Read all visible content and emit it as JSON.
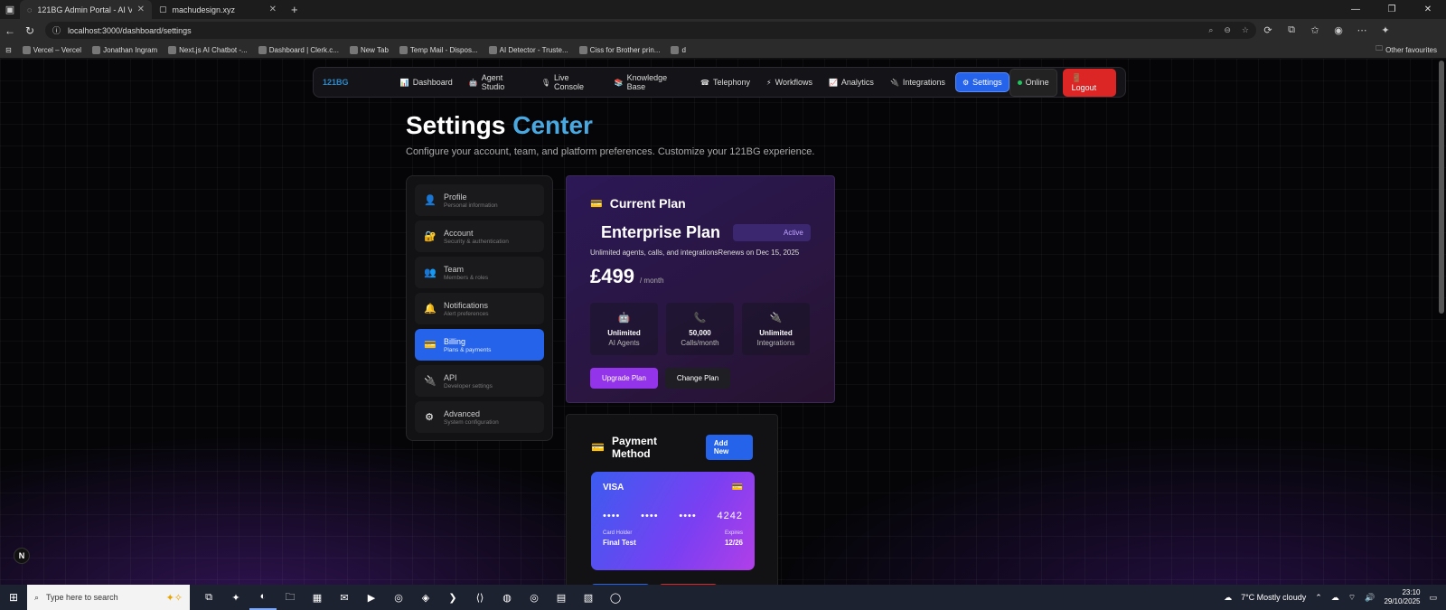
{
  "browser": {
    "tabs": [
      {
        "title": "121BG Admin Portal - AI Voice A",
        "active": true
      },
      {
        "title": "machudesign.xyz",
        "active": false
      }
    ],
    "url": "localhost:3000/dashboard/settings",
    "bookmarks": [
      "Vercel – Vercel",
      "Jonathan Ingram",
      "Next.js AI Chatbot -...",
      "Dashboard | Clerk.c...",
      "New Tab",
      "Temp Mail - Dispos...",
      "AI Detector - Truste...",
      "Ciss for Brother prin...",
      "d"
    ],
    "other_bookmarks": "Other favourites"
  },
  "nav": {
    "logo": "121BG",
    "items": [
      {
        "label": "Dashboard",
        "icon": "📊"
      },
      {
        "label": "Agent Studio",
        "icon": "🤖"
      },
      {
        "label": "Live Console",
        "icon": "🎙"
      },
      {
        "label": "Knowledge Base",
        "icon": "📚"
      },
      {
        "label": "Telephony",
        "icon": "☎"
      },
      {
        "label": "Workflows",
        "icon": "⚡"
      },
      {
        "label": "Analytics",
        "icon": "📈"
      },
      {
        "label": "Integrations",
        "icon": "🔌"
      },
      {
        "label": "Settings",
        "icon": "⚙"
      }
    ],
    "online": "Online",
    "logout": "Logout"
  },
  "header": {
    "title": "Settings",
    "title_accent": "Center",
    "subtitle": "Configure your account, team, and platform preferences. Customize your 121BG experience."
  },
  "sidebar": {
    "items": [
      {
        "name": "Profile",
        "desc": "Personal information",
        "icon": "👤"
      },
      {
        "name": "Account",
        "desc": "Security & authentication",
        "icon": "🔐"
      },
      {
        "name": "Team",
        "desc": "Members & roles",
        "icon": "👥"
      },
      {
        "name": "Notifications",
        "desc": "Alert preferences",
        "icon": "🔔"
      },
      {
        "name": "Billing",
        "desc": "Plans & payments",
        "icon": "💳"
      },
      {
        "name": "API",
        "desc": "Developer settings",
        "icon": "🔌"
      },
      {
        "name": "Advanced",
        "desc": "System configuration",
        "icon": "⚙"
      }
    ]
  },
  "plan": {
    "title": "Current Plan",
    "name": "Enterprise Plan",
    "status": "Active",
    "description": "Unlimited agents, calls, and integrations",
    "renewal": "Renews on Dec 15, 2025",
    "price": "£499",
    "period": "/ month",
    "features": [
      {
        "value": "Unlimited",
        "label": "AI Agents",
        "icon": "🤖"
      },
      {
        "value": "50,000",
        "label": "Calls/month",
        "icon": "📞"
      },
      {
        "value": "Unlimited",
        "label": "Integrations",
        "icon": "🔌"
      }
    ],
    "upgrade": "Upgrade Plan",
    "change": "Change Plan"
  },
  "payment": {
    "title": "Payment Method",
    "add": "Add New",
    "card": {
      "brand": "VISA",
      "groups": [
        "••••",
        "••••",
        "••••",
        "4242"
      ],
      "holder_label": "Card Holder",
      "holder": "Final Test",
      "expires_label": "Expires",
      "expires": "12/26"
    }
  },
  "taskbar": {
    "search": "Type here to search",
    "weather": "7°C Mostly cloudy",
    "time": "23:10",
    "date": "29/10/2025"
  }
}
